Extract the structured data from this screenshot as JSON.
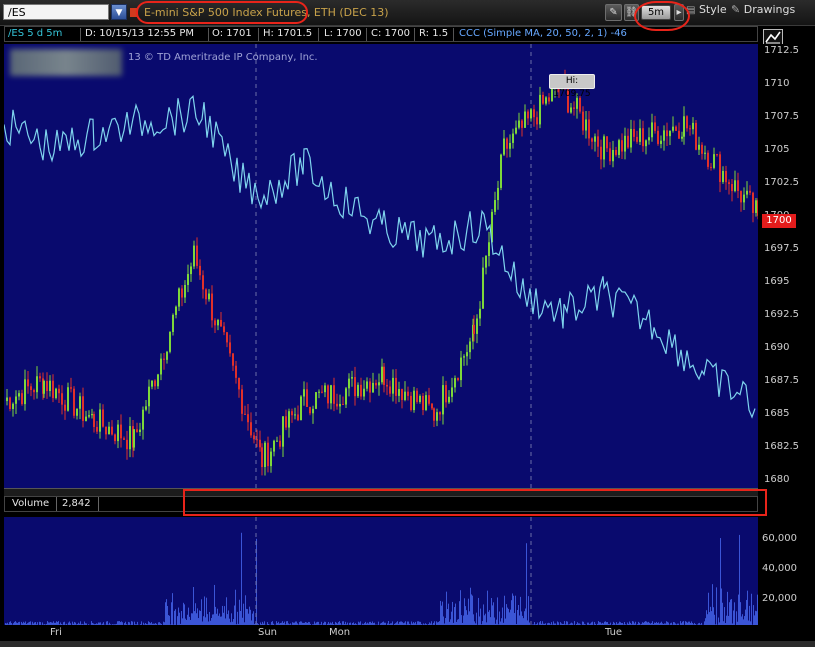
{
  "toolbar": {
    "symbol": "/ES",
    "description": "E-mini S&P 500 Index Futures, ETH (DEC 13)",
    "aggregation": "5m",
    "style_label": "Style",
    "drawings_label": "Drawings",
    "dropdown_glyph": "▼"
  },
  "info_bar": {
    "period": "/ES 5 d 5m",
    "date": "D: 10/15/13 12:55 PM",
    "open": "O: 1701",
    "high": "H: 1701.5",
    "low": "L: 1700",
    "close": "C: 1700",
    "range": "R: 1.5",
    "study": "CCC (Simple MA, 20, 50, 2, 1)",
    "study_value": "-46"
  },
  "chart": {
    "copyright": "13 © TD Ameritrade IP Company, Inc.",
    "hi_label": "Hi: 1709.75",
    "last_price": "1700",
    "price_ticks": [
      "1712.5",
      "1710",
      "1707.5",
      "1705",
      "1702.5",
      "1700",
      "1697.5",
      "1695",
      "1692.5",
      "1690",
      "1687.5",
      "1685",
      "1682.5",
      "1680"
    ],
    "volume_label": "Volume",
    "volume_value": "2,842",
    "volume_ticks": [
      "60,000",
      "40,000",
      "20,000"
    ],
    "time_ticks": [
      "Fri",
      "Sun",
      "Mon",
      "Tue"
    ],
    "colors": {
      "background": "#090a6e",
      "up": "#7dd83a",
      "down": "#e0302a",
      "study": "#7fd4ee",
      "volume": "#3b55d6",
      "annotation": "#e8241a"
    }
  },
  "chart_data": {
    "type": "line",
    "title": "E-mini S&P 500 Index Futures, ETH (DEC 13)",
    "xlabel": "",
    "ylabel": "",
    "ylim": [
      1680,
      1713
    ],
    "x": [
      "Fri",
      "Fri",
      "Fri",
      "Fri",
      "Fri",
      "Sun",
      "Sun",
      "Mon",
      "Mon",
      "Mon",
      "Mon",
      "Mon",
      "Tue",
      "Tue",
      "Tue",
      "Tue"
    ],
    "series": [
      {
        "name": "/ES",
        "values": [
          1686,
          1687.5,
          1684.5,
          1683,
          1697,
          1681.5,
          1686,
          1686.5,
          1688,
          1685,
          1691,
          1705,
          1709.75,
          1705,
          1707,
          1700
        ]
      }
    ],
    "grid": false,
    "legend": "none"
  }
}
